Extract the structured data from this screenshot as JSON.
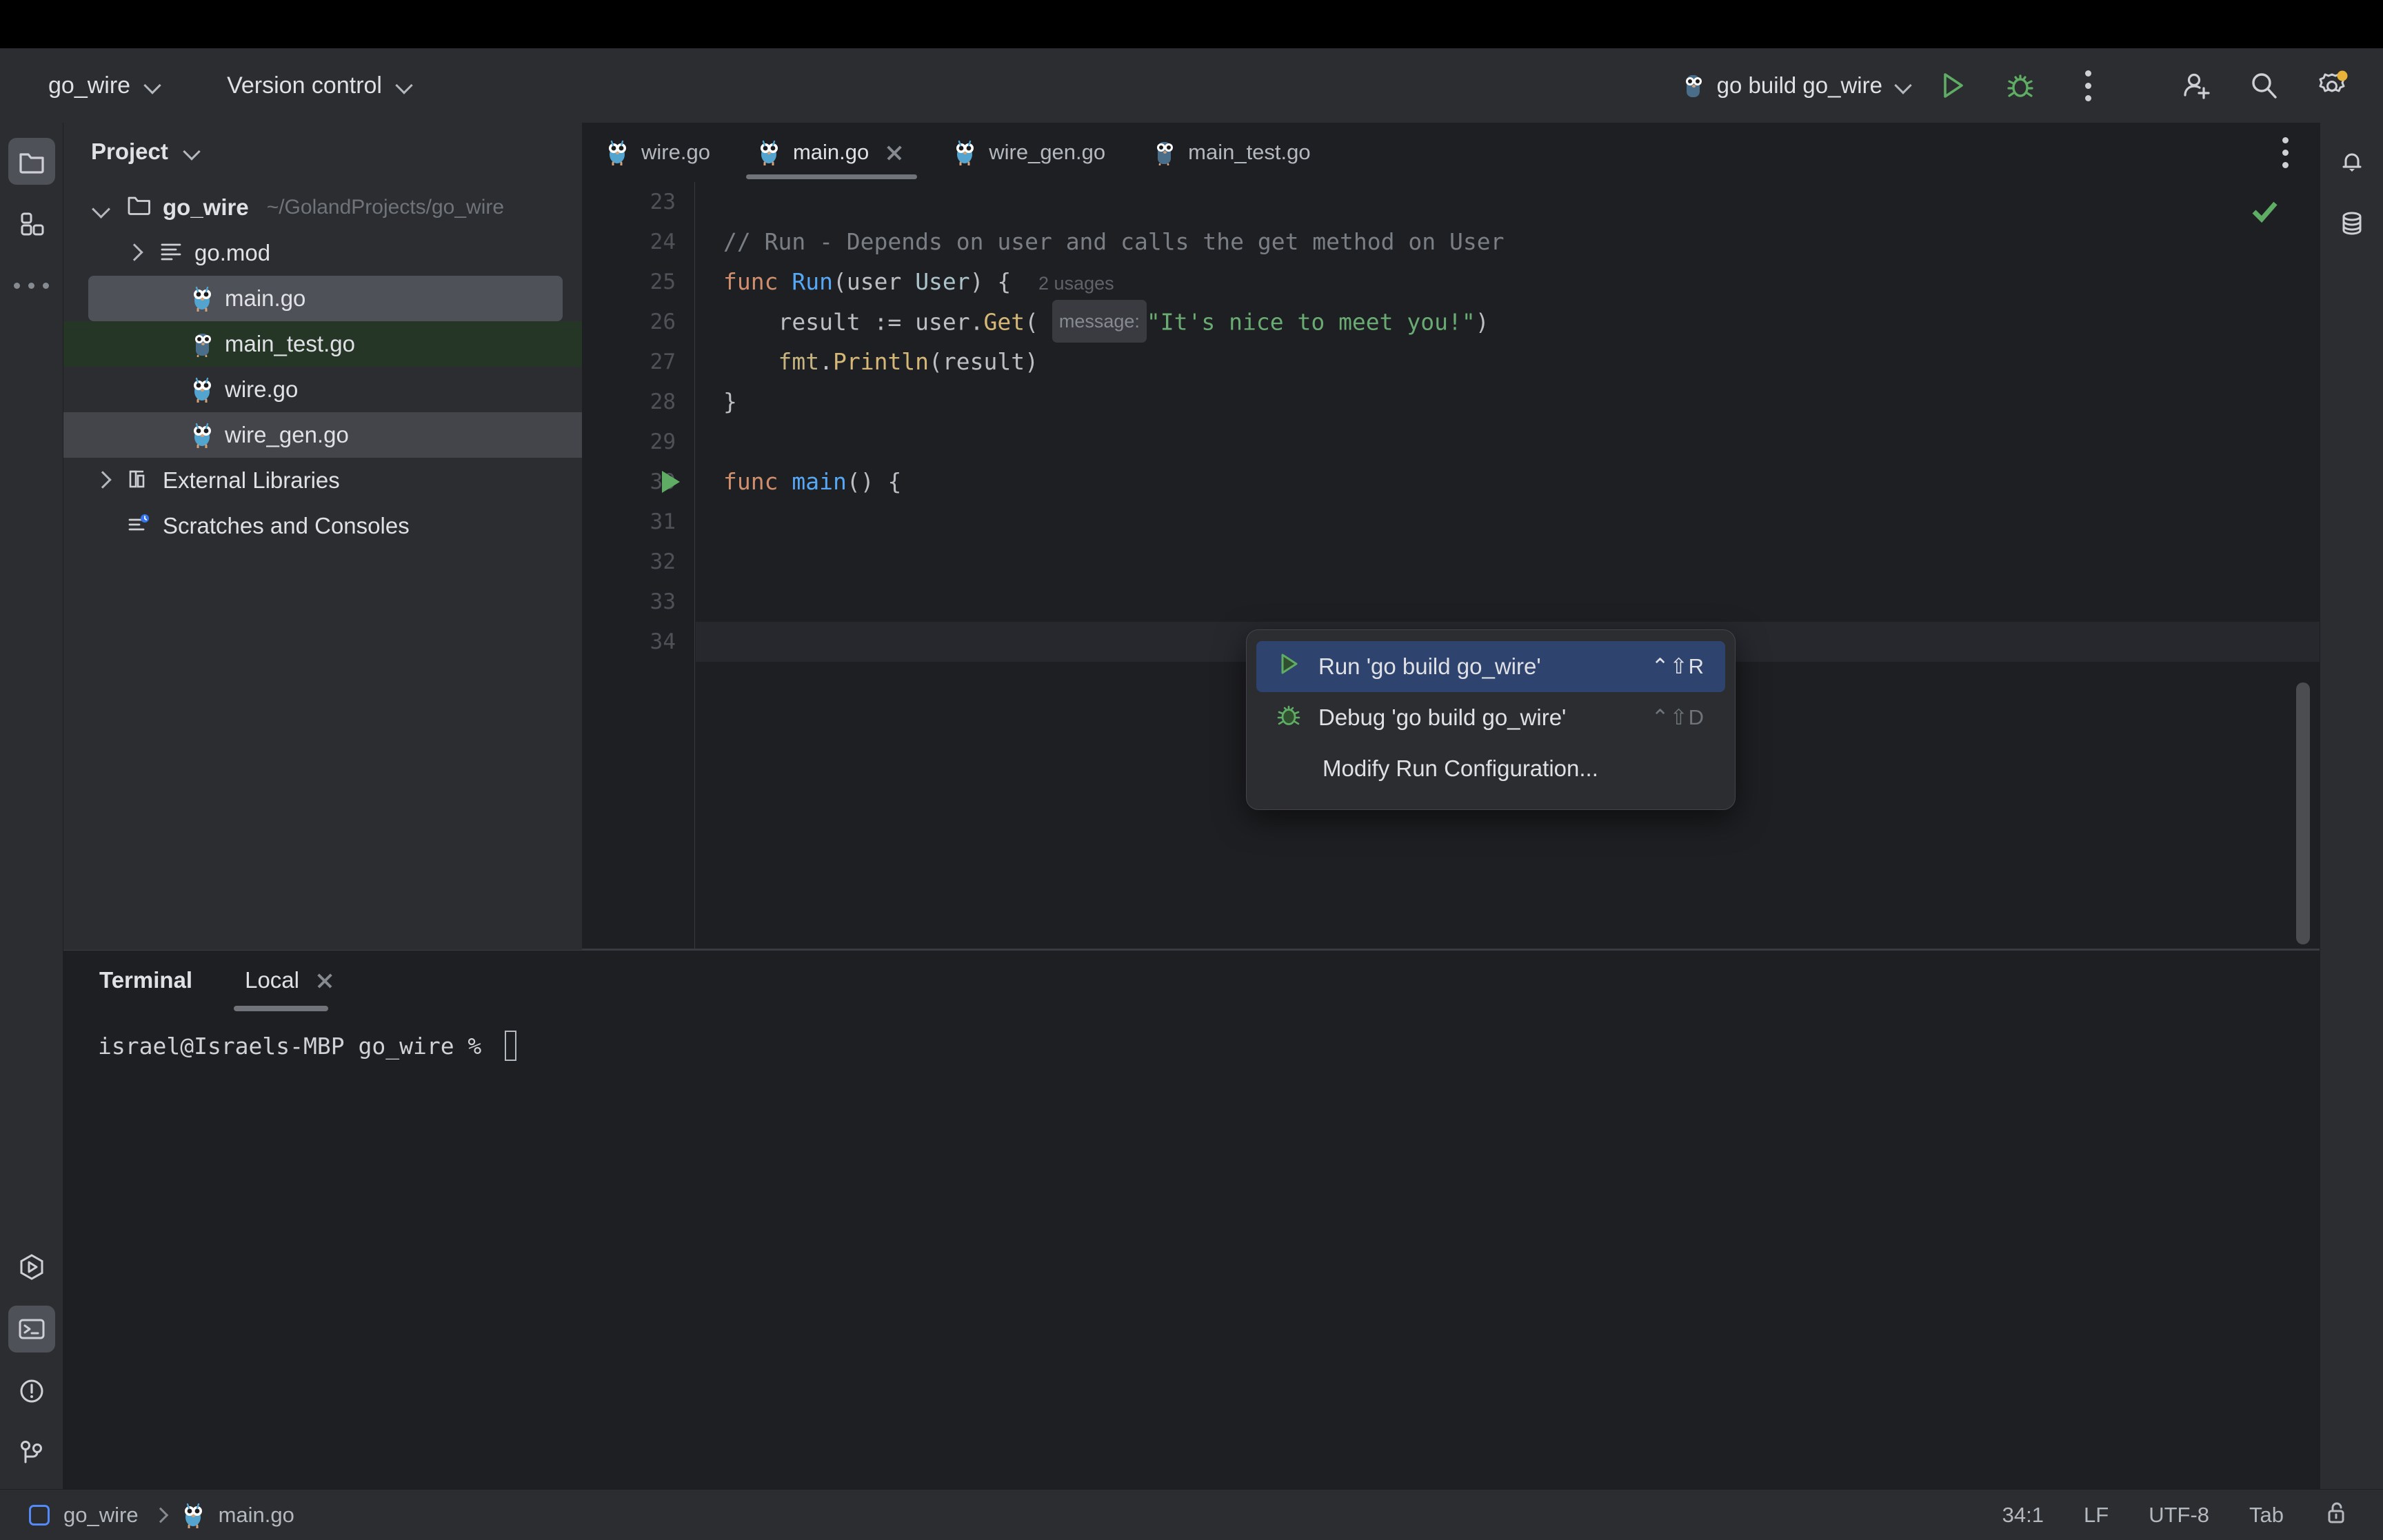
{
  "toolbar": {
    "project_menu": "go_wire",
    "vcs_menu": "Version control",
    "run_config": "go build go_wire",
    "icons": {
      "run": "run-icon",
      "debug": "debug-icon",
      "more": "more-vertical-icon",
      "add_user": "add-user-icon",
      "search": "search-icon",
      "settings": "settings-gear-icon"
    }
  },
  "left_rail": {
    "top": [
      {
        "name": "project-tool-window",
        "icon": "folder-icon",
        "active": true
      },
      {
        "name": "structure-tool-window",
        "icon": "blocks-icon",
        "active": false
      },
      {
        "name": "more-tool-windows",
        "icon": "ellipsis-icon",
        "active": false
      }
    ],
    "bottom": [
      {
        "name": "run-tool-window",
        "icon": "run-hexagon-icon",
        "active": false
      },
      {
        "name": "terminal-tool-window",
        "icon": "terminal-icon",
        "active": true
      },
      {
        "name": "problems-tool-window",
        "icon": "warning-circle-icon",
        "active": false
      },
      {
        "name": "version-control-tool-window",
        "icon": "git-branch-icon",
        "active": false
      }
    ]
  },
  "right_rail": [
    {
      "name": "notifications",
      "icon": "bell-icon"
    },
    {
      "name": "database",
      "icon": "database-icon"
    }
  ],
  "project_panel": {
    "title": "Project",
    "tree": [
      {
        "label": "go_wire",
        "sub": "~/GolandProjects/go_wire",
        "icon": "folder-icon",
        "twisty": "down",
        "indent": 0,
        "bold": true,
        "state": "none"
      },
      {
        "label": "go.mod",
        "sub": "",
        "icon": "mod-file-icon",
        "twisty": "right",
        "indent": 1,
        "bold": false,
        "state": "none"
      },
      {
        "label": "main.go",
        "sub": "",
        "icon": "go-file-icon",
        "twisty": "none",
        "indent": 2,
        "bold": false,
        "state": "selected-focus"
      },
      {
        "label": "main_test.go",
        "sub": "",
        "icon": "go-test-file-icon",
        "twisty": "none",
        "indent": 2,
        "bold": false,
        "state": "selected-green"
      },
      {
        "label": "wire.go",
        "sub": "",
        "icon": "go-file-icon",
        "twisty": "none",
        "indent": 2,
        "bold": false,
        "state": "none"
      },
      {
        "label": "wire_gen.go",
        "sub": "",
        "icon": "go-file-icon",
        "twisty": "none",
        "indent": 2,
        "bold": false,
        "state": "selected-gray"
      },
      {
        "label": "External Libraries",
        "sub": "",
        "icon": "library-icon",
        "twisty": "right",
        "indent": 0,
        "bold": false,
        "state": "none"
      },
      {
        "label": "Scratches and Consoles",
        "sub": "",
        "icon": "scratches-icon",
        "twisty": "none",
        "indent": 0,
        "bold": false,
        "state": "none"
      }
    ]
  },
  "editor": {
    "tabs": [
      {
        "label": "wire.go",
        "icon": "go-file-icon",
        "active": false,
        "closable": false
      },
      {
        "label": "main.go",
        "icon": "go-file-icon",
        "active": true,
        "closable": true
      },
      {
        "label": "wire_gen.go",
        "icon": "go-file-icon",
        "active": false,
        "closable": false
      },
      {
        "label": "main_test.go",
        "icon": "go-test-file-icon",
        "active": false,
        "closable": false
      }
    ],
    "first_line_number": 23,
    "lines": [
      {
        "n": 23,
        "text": "",
        "current": false,
        "run_marker": false
      },
      {
        "n": 24,
        "text": "// Run - Depends on user and calls the get method on User",
        "current": false,
        "run_marker": false
      },
      {
        "n": 25,
        "text": "func Run(user User) {",
        "current": false,
        "run_marker": false,
        "inlay": "2 usages"
      },
      {
        "n": 26,
        "text": "    result := user.Get( message: \"It's nice to meet you!\")",
        "current": false,
        "run_marker": false,
        "hint": "message:"
      },
      {
        "n": 27,
        "text": "    fmt.Println(result)",
        "current": false,
        "run_marker": false
      },
      {
        "n": 28,
        "text": "}",
        "current": false,
        "run_marker": false
      },
      {
        "n": 29,
        "text": "",
        "current": false,
        "run_marker": false
      },
      {
        "n": 30,
        "text": "func main() {",
        "current": false,
        "run_marker": true
      },
      {
        "n": 31,
        "text": "",
        "current": false,
        "run_marker": false
      },
      {
        "n": 32,
        "text": "",
        "current": false,
        "run_marker": false
      },
      {
        "n": 33,
        "text": "",
        "current": false,
        "run_marker": false
      },
      {
        "n": 34,
        "text": "",
        "current": true,
        "run_marker": false
      }
    ],
    "inspection_status": "ok-checkmark"
  },
  "context_menu": {
    "items": [
      {
        "label": "Run 'go build go_wire'",
        "shortcut": "⌃⇧R",
        "icon": "run-icon",
        "selected": true
      },
      {
        "label": "Debug 'go build go_wire'",
        "shortcut": "⌃⇧D",
        "icon": "debug-icon",
        "selected": false
      },
      {
        "label": "Modify Run Configuration...",
        "shortcut": "",
        "icon": "",
        "selected": false
      }
    ]
  },
  "terminal": {
    "title": "Terminal",
    "tabs": [
      {
        "label": "Local",
        "active": true,
        "closable": true
      }
    ],
    "prompt": "israel@Israels-MBP go_wire % "
  },
  "status_bar": {
    "breadcrumb": [
      "go_wire",
      "main.go"
    ],
    "caret_position": "34:1",
    "line_separator": "LF",
    "encoding": "UTF-8",
    "indent": "Tab",
    "lock_icon": "unlocked-icon"
  },
  "colors": {
    "accent_green": "#5FAD65",
    "selection_blue": "#2E436E",
    "toolbar_bg": "#2B2D30",
    "editor_bg": "#1E1F22",
    "badge_orange": "#E8B339"
  }
}
